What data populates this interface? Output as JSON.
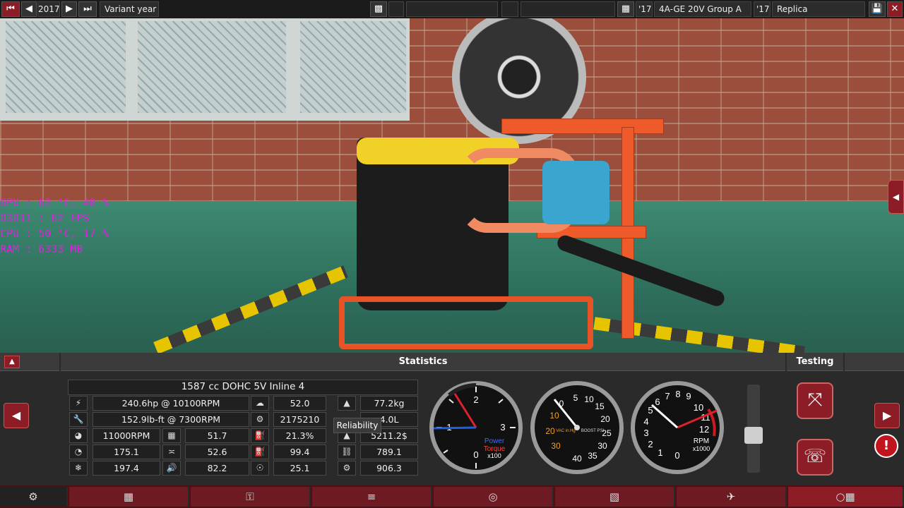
{
  "topbar": {
    "year": "2017",
    "variant_label": "Variant year",
    "engine_year": "'17",
    "engine_name": "4A-GE 20V Group A",
    "variant_year": "'17",
    "variant_name": "Replica"
  },
  "osd": {
    "lines": [
      "GPU    : 62 °C, 48 %",
      "D3D11  : 62 FPS",
      "CPU    : 50 °C, 17 %",
      "RAM    : 6333 MB"
    ]
  },
  "panel": {
    "title": "Statistics",
    "right_title": "Testing",
    "engine_desc": "1587 cc DOHC 5V Inline 4",
    "tooltip": "Reliability"
  },
  "stats": {
    "power": "240.6hp @ 10100RPM",
    "torque": "152.9lb-ft @ 7300RPM",
    "redline": "11000RPM",
    "c1": "175.1",
    "c2": "197.4",
    "smooth": "51.7",
    "resp": "52.6",
    "noise": "82.2",
    "v1": "52.0",
    "v2": "2175210",
    "v3": "21.3%",
    "v4": "99.4",
    "v5": "25.1",
    "weight": "77.2kg",
    "fuel": "4.0L",
    "cost": "5211.2$",
    "w4": "789.1",
    "w5": "906.3"
  },
  "gauges": {
    "power": {
      "labels": [
        "0",
        "1",
        "2",
        "3"
      ],
      "unit_line1": "Power",
      "unit_line2": "Torque",
      "scale": "x100"
    },
    "boost": {
      "labels": [
        "10",
        "20",
        "30",
        "0",
        "5",
        "10",
        "15",
        "20",
        "25",
        "30",
        "35",
        "40"
      ],
      "vac": "VAC in.Hg",
      "boost": "BOOST PSI"
    },
    "rpm": {
      "labels": [
        "0",
        "1",
        "2",
        "3",
        "4",
        "5",
        "6",
        "7",
        "8",
        "9",
        "10",
        "11",
        "12"
      ],
      "unit": "RPM",
      "scale": "x1000"
    }
  },
  "colors": {
    "accent": "#8c1d26",
    "orange": "#ef5a2a",
    "floor": "#2e6e5c"
  },
  "nav": {
    "prev_arrow": "◀",
    "next_arrow": "▶",
    "collapse": "▲",
    "side_tab": "◀",
    "warn": "!",
    "bottom_items": [
      "⚙",
      "▦",
      "⚿",
      "≡",
      "◎",
      "▧",
      "✈",
      "○▦"
    ]
  }
}
